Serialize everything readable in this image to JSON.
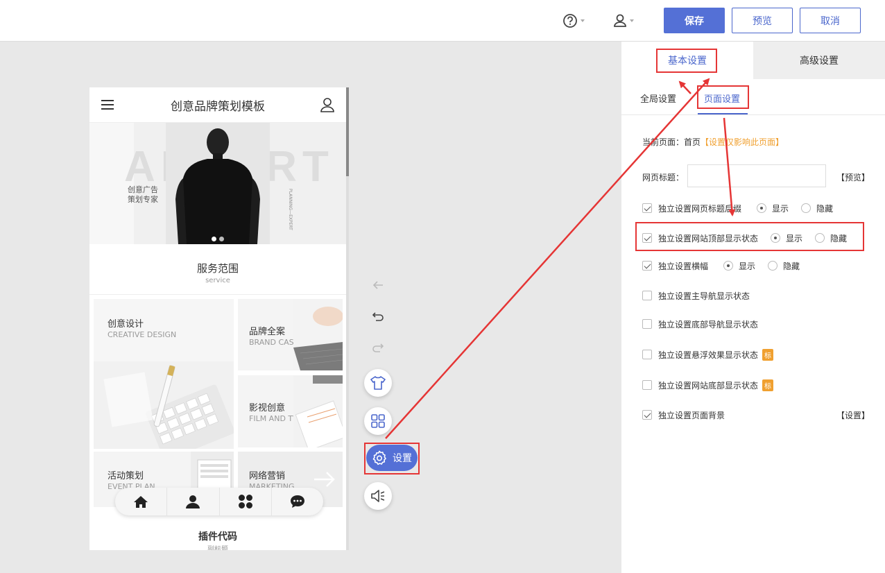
{
  "toolbar": {
    "save_label": "保存",
    "preview_label": "预览",
    "cancel_label": "取消"
  },
  "phone": {
    "title": "创意品牌策划模板",
    "banner": {
      "big_text": "ADVERT",
      "sub_text_1": "创意广告",
      "sub_text_2": "策划专家",
      "vertical_text": "PLANNING—EXPERT"
    },
    "service": {
      "title": "服务范围",
      "subtitle": "service"
    },
    "cards": [
      {
        "cn": "创意设计",
        "en": "CREATIVE DESIGN"
      },
      {
        "cn": "品牌全案",
        "en": "BRAND CASE"
      },
      {
        "cn": "影视创意",
        "en": "FILM AND TV"
      },
      {
        "cn": "活动策划",
        "en": "EVENT PLAN"
      },
      {
        "cn": "网络营销",
        "en": "MARKETING"
      }
    ],
    "plugin": {
      "title": "插件代码",
      "subtitle": "副标题"
    }
  },
  "side_tools": {
    "settings_label": "设置"
  },
  "panel": {
    "tabs": {
      "basic": "基本设置",
      "advanced": "高级设置"
    },
    "subtabs": {
      "global": "全局设置",
      "page": "页面设置"
    },
    "current_page_label": "当前页面：首页",
    "current_page_note": "【设置仅影响此页面】",
    "title_label": "网页标题：",
    "title_value": "",
    "title_preview": "【预览】",
    "show_label": "显示",
    "hide_label": "隐藏",
    "options": [
      {
        "label": "独立设置网页标题后缀",
        "checked": true
      },
      {
        "label": "独立设置网站顶部显示状态",
        "checked": true
      },
      {
        "label": "独立设置横幅",
        "checked": true
      },
      {
        "label": "独立设置主导航显示状态",
        "checked": false
      },
      {
        "label": "独立设置底部导航显示状态",
        "checked": false
      },
      {
        "label": "独立设置悬浮效果显示状态",
        "checked": false,
        "badge": "标"
      },
      {
        "label": "独立设置网站底部显示状态",
        "checked": false,
        "badge": "标"
      },
      {
        "label": "独立设置页面背景",
        "checked": true,
        "link": "【设置】"
      }
    ]
  },
  "colors": {
    "primary": "#5470d6",
    "annotation": "#e53535",
    "warning": "#f0a030"
  }
}
